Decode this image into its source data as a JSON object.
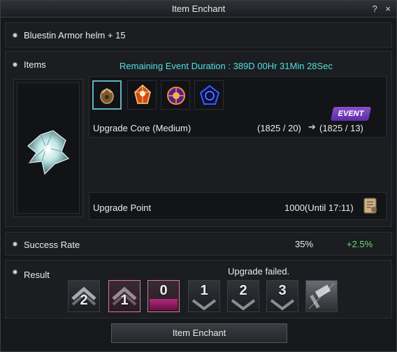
{
  "window": {
    "title": "Item Enchant",
    "help_label": "?",
    "close_label": "×"
  },
  "target": {
    "name": "Bluestin Armor helm + 15"
  },
  "items": {
    "section_label": "Items",
    "event_duration": "Remaining Event Duration : 389D 00Hr 31Min 28Sec",
    "materials": [
      {
        "icon": "armor-core-icon"
      },
      {
        "icon": "red-crystal-icon"
      },
      {
        "icon": "spark-orb-icon"
      },
      {
        "icon": "blue-pentagon-icon"
      }
    ],
    "event_badge": "EVENT",
    "upgrade_core": {
      "label": "Upgrade Core (Medium)",
      "from": "(1825 / 20)",
      "to": "(1825 / 13)"
    },
    "upgrade_point": {
      "label": "Upgrade Point",
      "value": "1000(Until 17:11)"
    }
  },
  "success": {
    "label": "Success Rate",
    "rate": "35%",
    "bonus": "+2.5%"
  },
  "result": {
    "label": "Result",
    "message": "Upgrade failed.",
    "slots": [
      {
        "value": "2",
        "style": "grey"
      },
      {
        "value": "1",
        "style": "pink"
      },
      {
        "value": "0",
        "style": "pink"
      },
      {
        "value": "1",
        "style": "dark"
      },
      {
        "value": "2",
        "style": "dark"
      },
      {
        "value": "3",
        "style": "dark"
      }
    ]
  },
  "action": {
    "enchant_label": "Item Enchant"
  },
  "colors": {
    "accent": "#4fe0e0",
    "bonus": "#6fdc6f",
    "event": "#7b3fc9",
    "selected": "#5fb3c4"
  }
}
